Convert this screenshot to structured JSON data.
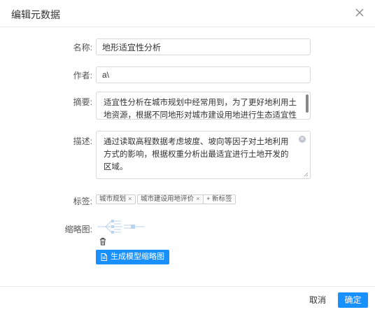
{
  "dialog": {
    "title": "编辑元数据",
    "close_icon": "close-icon"
  },
  "form": {
    "name_label": "名称:",
    "name_value": "地形适宜性分析",
    "author_label": "作者:",
    "author_value": "a\\",
    "summary_label": "摘要:",
    "summary_text": "适宜性分析在城市规划中经常用到，为了更好地利用土地资源，根据不同地形对城市建设用地进行生态适宜性评价，以实现山地城市",
    "description_label": "描述:",
    "description_text": "通过读取高程数据考虑坡度、坡向等因子对土地利用方式的影响，根据权重分析出最适宜进行土地开发的区域。",
    "tags_label": "标签:",
    "tags": [
      {
        "label": "城市规划"
      },
      {
        "label": "城市建设用地评价"
      }
    ],
    "new_tag_label": "+ 新标签",
    "thumbnail_label": "缩略图:",
    "generate_button_label": "生成模型缩略图"
  },
  "footer": {
    "cancel_label": "取消",
    "ok_label": "确定"
  },
  "colors": {
    "primary": "#1890ff",
    "border": "#d9d9d9"
  }
}
